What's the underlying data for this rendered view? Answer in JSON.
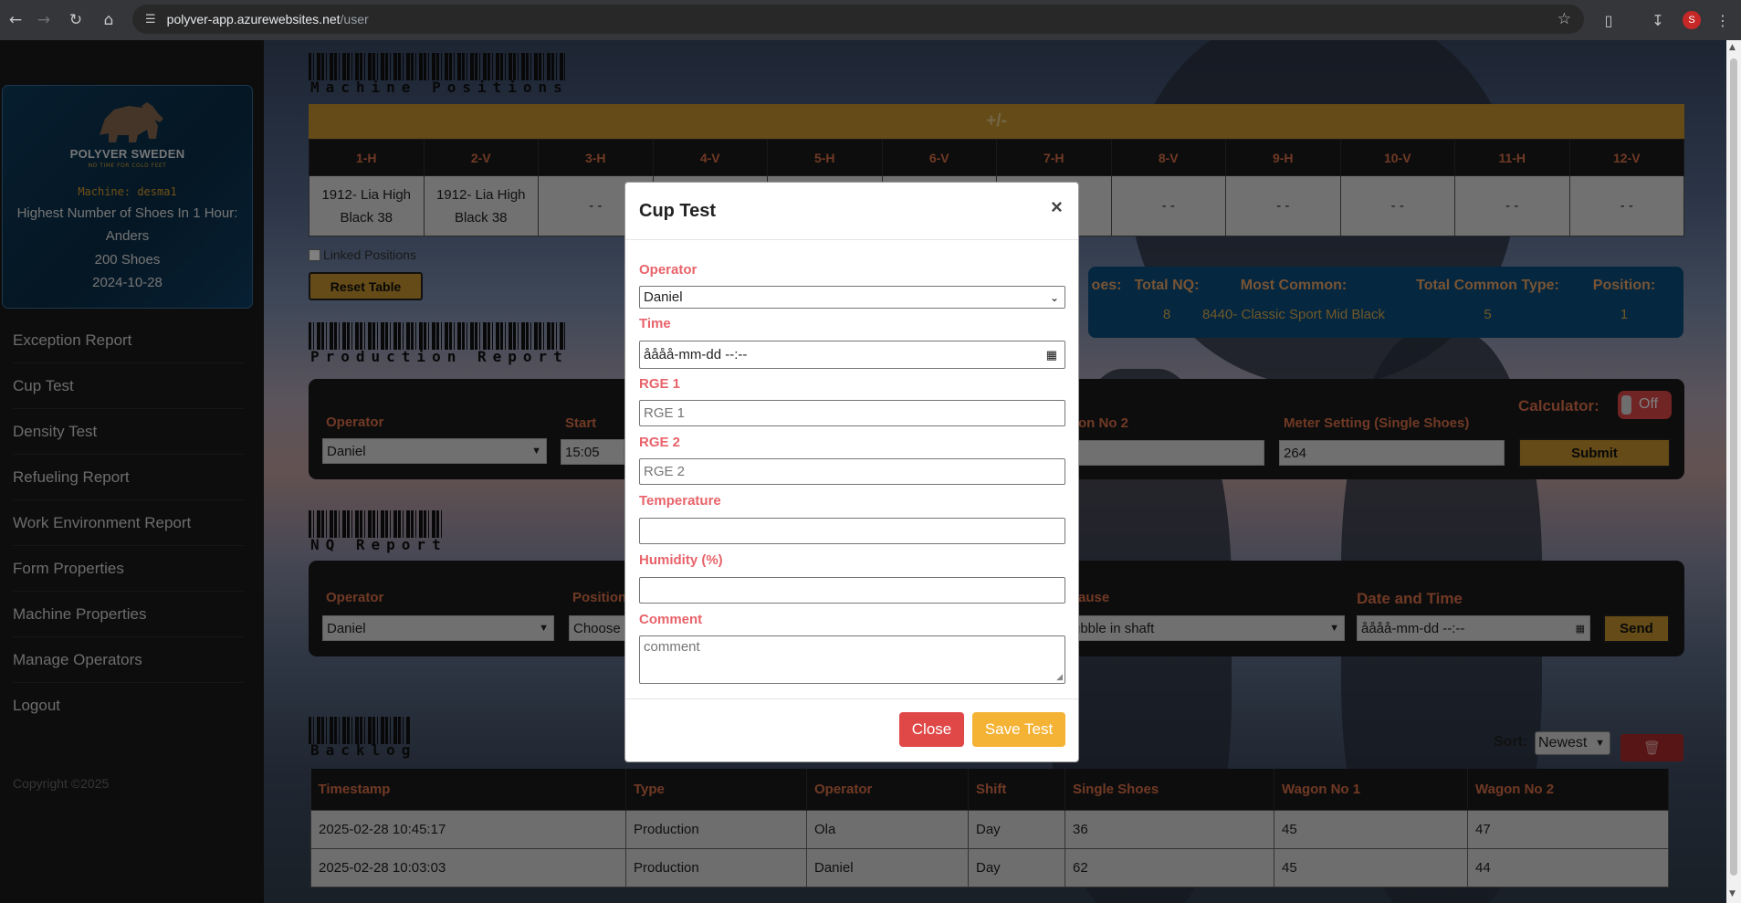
{
  "browser": {
    "url_host": "polyver-app.azurewebsites.net",
    "url_path": "/user",
    "profile_initial": "S"
  },
  "sidebar": {
    "brand": "POLYVER SWEDEN",
    "tagline": "NO TIME FOR COLD FEET",
    "machine": "Machine: desma1",
    "record_label": "Highest Number of Shoes In 1 Hour:",
    "record_operator": "Anders",
    "record_count": "200 Shoes",
    "record_date": "2024-10-28",
    "menu": [
      "Exception Report",
      "Cup Test",
      "Density Test",
      "Refueling Report",
      "Work Environment Report",
      "Form Properties",
      "Machine Properties",
      "Manage Operators",
      "Logout"
    ],
    "copyright": "Copyright ©2025"
  },
  "machine_positions": {
    "title": "Machine Positions",
    "toggle": "+/-",
    "headers": [
      "1-H",
      "2-V",
      "3-H",
      "4-V",
      "5-H",
      "6-V",
      "7-H",
      "8-V",
      "9-H",
      "10-V",
      "11-H",
      "12-V"
    ],
    "cells": [
      "1912- Lia High Black 38",
      "1912- Lia High Black 38",
      "- -",
      "- -",
      "- -",
      "- -",
      "- -",
      "- -",
      "- -",
      "- -",
      "- -",
      "- -"
    ],
    "linked_label": "Linked Positions",
    "reset_label": "Reset Table"
  },
  "stats": {
    "labels": [
      "oes:",
      "Total NQ:",
      "Most Common:",
      "Total Common Type:",
      "Position:"
    ],
    "values": [
      "",
      "8",
      "8440- Classic Sport Mid Black",
      "5",
      "1"
    ]
  },
  "production": {
    "title": "Production Report",
    "operator_label": "Operator",
    "operator_value": "Daniel",
    "start_label": "Start",
    "start_value": "15:05",
    "wagon2_label": "on No 2",
    "meter_label": "Meter Setting (Single Shoes)",
    "meter_value": "264",
    "calculator_label": "Calculator:",
    "calculator_state": "Off",
    "submit_label": "Submit"
  },
  "nq": {
    "title": "NQ Report",
    "operator_label": "Operator",
    "operator_value": "Daniel",
    "position_label": "Position",
    "position_value": "Choose",
    "cause_label": "ause",
    "cause_value": "ubble in shaft",
    "datetime_label": "Date and Time",
    "datetime_value": "åååå-mm-dd --:--",
    "send_label": "Send"
  },
  "backlog": {
    "title": "Backlog",
    "sort_label": "Sort:",
    "sort_value": "Newest",
    "headers": [
      "Timestamp",
      "Type",
      "Operator",
      "Shift",
      "Single Shoes",
      "Wagon No 1",
      "Wagon No 2"
    ],
    "rows": [
      [
        "2025-02-28 10:45:17",
        "Production",
        "Ola",
        "Day",
        "36",
        "45",
        "47"
      ],
      [
        "2025-02-28 10:03:03",
        "Production",
        "Daniel",
        "Day",
        "62",
        "45",
        "44"
      ]
    ]
  },
  "modal": {
    "title": "Cup Test",
    "close_x": "×",
    "operator_label": "Operator",
    "operator_value": "Daniel",
    "time_label": "Time",
    "time_value": "åååå-mm-dd --:--",
    "rge1_label": "RGE 1",
    "rge1_placeholder": "RGE 1",
    "rge2_label": "RGE 2",
    "rge2_placeholder": "RGE 2",
    "temperature_label": "Temperature",
    "humidity_label": "Humidity (%)",
    "comment_label": "Comment",
    "comment_placeholder": "comment",
    "close_button": "Close",
    "save_button": "Save Test",
    "close_color": "#e04848",
    "save_color": "#f5b335"
  }
}
